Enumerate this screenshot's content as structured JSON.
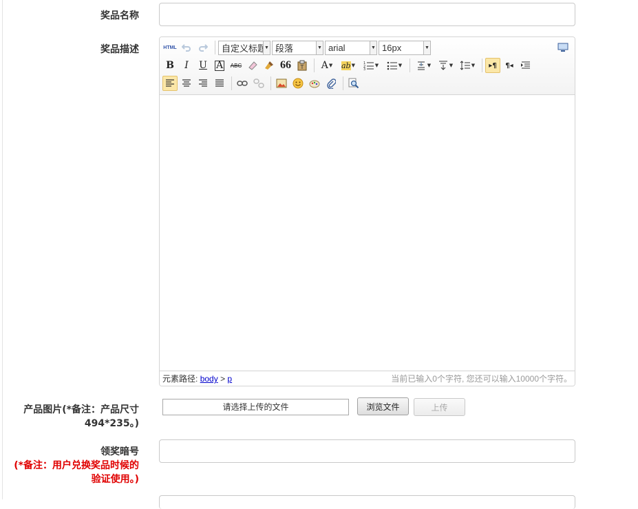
{
  "form": {
    "prize_name_label": "奖品名称",
    "prize_name_value": "",
    "prize_desc_label": "奖品描述",
    "product_image_label_line1": "产品图片(*备注：产品尺寸",
    "product_image_label_line2": "494*235。)",
    "file_placeholder": "请选择上传的文件",
    "browse_button": "浏览文件",
    "upload_button": "上传",
    "code_label": "领奖暗号",
    "code_note_line1": "(*备注：用户兑换奖品时候的",
    "code_note_line2": "验证使用。)",
    "code_value": ""
  },
  "editor": {
    "html_btn": "HTML",
    "custom_title_select": "自定义标题",
    "paragraph_select": "段落",
    "font_family_select": "arial",
    "font_size_select": "16px",
    "bold": "B",
    "italic": "I",
    "underline": "U",
    "font_border": "A",
    "strikethrough": "ABC",
    "quote": "66",
    "forecolor": "A",
    "backcolor": "ab",
    "ltr": "▸¶",
    "rtl": "¶◂",
    "element_path_label": "元素路径:",
    "path_body": "body",
    "path_sep": ">",
    "path_p": "p",
    "word_count": "当前已输入0个字符, 您还可以输入10000个字符。",
    "body_content": ""
  },
  "colors": {
    "note_red": "#e00000",
    "active_btn": "#fbe7a8"
  }
}
